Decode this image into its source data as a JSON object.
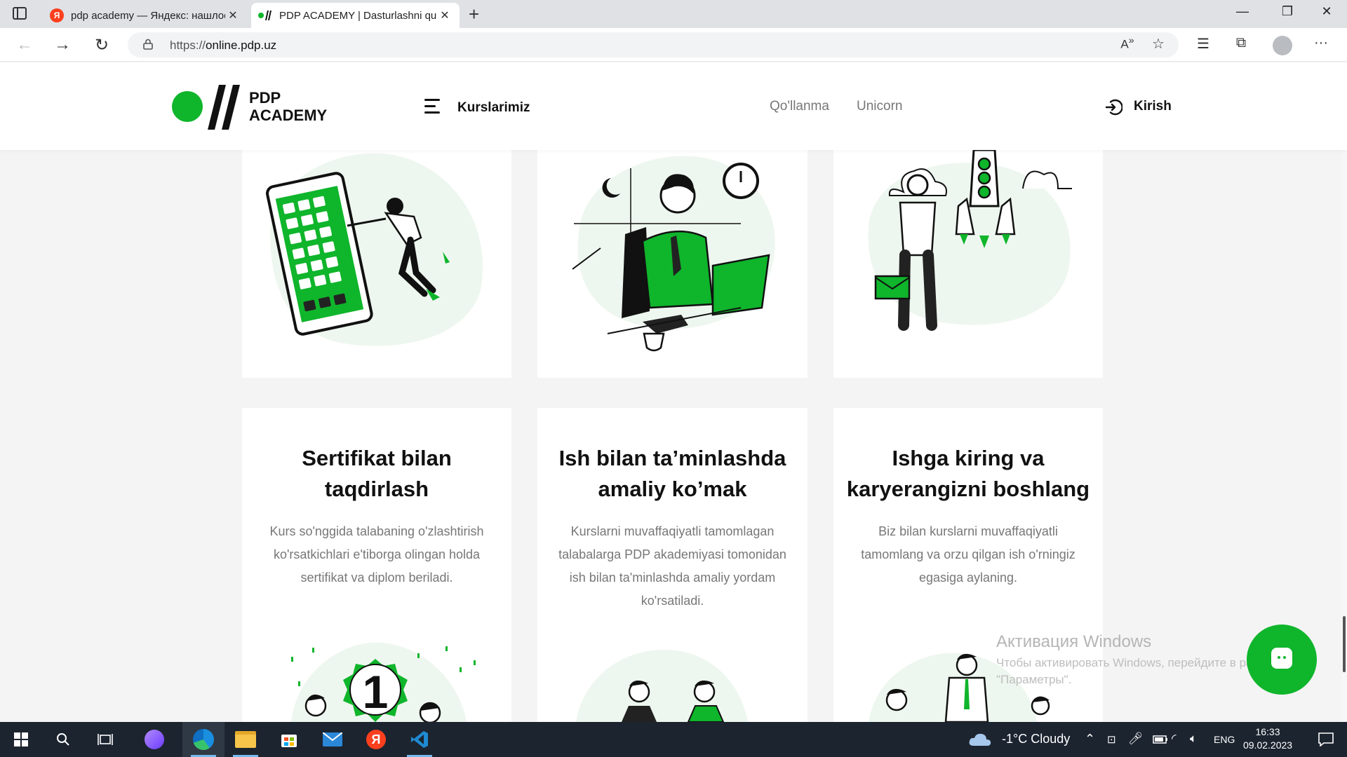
{
  "browser": {
    "tabs": [
      {
        "title": "pdp academy — Яндекс: нашлось",
        "favicon": "yandex-icon",
        "active": false
      },
      {
        "title": "PDP ACADEMY | Dasturlashni qu",
        "favicon": "pdp-favicon",
        "active": true
      }
    ],
    "url_prefix": "https://",
    "url_host": "online.pdp.uz"
  },
  "site": {
    "logo_line1": "PDP",
    "logo_line2": "ACADEMY",
    "nav": {
      "courses": "Kurslarimiz",
      "guide": "Qo'llanma",
      "unicorn": "Unicorn",
      "login": "Kirish"
    },
    "cards": [
      {
        "title_line1": "Sertifikat bilan",
        "title_line2": "taqdirlash",
        "text": "Kurs so'nggida talabaning o'zlashtirish ko'rsatkichlari e'tiborga olingan holda sertifikat va diplom beriladi."
      },
      {
        "title_line1": "Ish bilan ta’minlashda",
        "title_line2": "amaliy ko’mak",
        "text": "Kurslarni muvaffaqiyatli tamomlagan talabalarga PDP akademiyasi tomonidan ish bilan ta'minlashda amaliy yordam ko'rsatiladi."
      },
      {
        "title_line1": "Ishga kiring va",
        "title_line2": "karyerangizni boshlang",
        "text": "Biz bilan kurslarni muvaffaqiyatli tamomlang va orzu qilgan ish o'rningiz egasiga aylaning."
      }
    ],
    "badge_number": "1",
    "brand_color": "#0fb52b"
  },
  "watermark": {
    "title": "Активация Windows",
    "line1": "Чтобы активировать Windows, перейдите в раздел",
    "line2": "\"Параметры\"."
  },
  "taskbar": {
    "weather": "-1°C  Cloudy",
    "lang": "ENG",
    "time": "16:33",
    "date": "09.02.2023"
  }
}
